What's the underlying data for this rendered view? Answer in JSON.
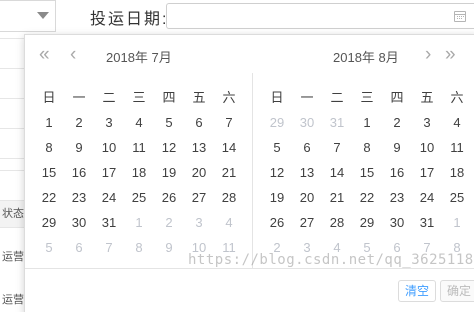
{
  "form": {
    "date_label": "投运日期:",
    "status_label": "状态",
    "row_labels": [
      "运营",
      "运营"
    ]
  },
  "picker": {
    "nav": {
      "prev_year": "«",
      "prev_month": "‹",
      "next_month": "›",
      "next_year": "»"
    },
    "weekdays": [
      "日",
      "一",
      "二",
      "三",
      "四",
      "五",
      "六"
    ],
    "left": {
      "title": "2018年  7月",
      "weeks": [
        [
          {
            "d": "1"
          },
          {
            "d": "2"
          },
          {
            "d": "3"
          },
          {
            "d": "4"
          },
          {
            "d": "5"
          },
          {
            "d": "6"
          },
          {
            "d": "7"
          }
        ],
        [
          {
            "d": "8"
          },
          {
            "d": "9"
          },
          {
            "d": "10"
          },
          {
            "d": "11"
          },
          {
            "d": "12"
          },
          {
            "d": "13"
          },
          {
            "d": "14"
          }
        ],
        [
          {
            "d": "15"
          },
          {
            "d": "16"
          },
          {
            "d": "17"
          },
          {
            "d": "18"
          },
          {
            "d": "19"
          },
          {
            "d": "20"
          },
          {
            "d": "21"
          }
        ],
        [
          {
            "d": "22"
          },
          {
            "d": "23"
          },
          {
            "d": "24"
          },
          {
            "d": "25"
          },
          {
            "d": "26"
          },
          {
            "d": "27"
          },
          {
            "d": "28"
          }
        ],
        [
          {
            "d": "29"
          },
          {
            "d": "30"
          },
          {
            "d": "31"
          },
          {
            "d": "1",
            "dim": true
          },
          {
            "d": "2",
            "dim": true
          },
          {
            "d": "3",
            "dim": true
          },
          {
            "d": "4",
            "dim": true
          }
        ],
        [
          {
            "d": "5",
            "dim": true
          },
          {
            "d": "6",
            "dim": true
          },
          {
            "d": "7",
            "dim": true
          },
          {
            "d": "8",
            "dim": true
          },
          {
            "d": "9",
            "dim": true
          },
          {
            "d": "10",
            "dim": true
          },
          {
            "d": "11",
            "dim": true
          }
        ]
      ]
    },
    "right": {
      "title": "2018年  8月",
      "weeks": [
        [
          {
            "d": "29",
            "dim": true
          },
          {
            "d": "30",
            "dim": true
          },
          {
            "d": "31",
            "dim": true
          },
          {
            "d": "1"
          },
          {
            "d": "2"
          },
          {
            "d": "3"
          },
          {
            "d": "4"
          }
        ],
        [
          {
            "d": "5"
          },
          {
            "d": "6"
          },
          {
            "d": "7"
          },
          {
            "d": "8"
          },
          {
            "d": "9"
          },
          {
            "d": "10"
          },
          {
            "d": "11"
          }
        ],
        [
          {
            "d": "12"
          },
          {
            "d": "13"
          },
          {
            "d": "14"
          },
          {
            "d": "15"
          },
          {
            "d": "16"
          },
          {
            "d": "17"
          },
          {
            "d": "18"
          }
        ],
        [
          {
            "d": "19"
          },
          {
            "d": "20"
          },
          {
            "d": "21"
          },
          {
            "d": "22"
          },
          {
            "d": "23"
          },
          {
            "d": "24"
          },
          {
            "d": "25"
          }
        ],
        [
          {
            "d": "26"
          },
          {
            "d": "27"
          },
          {
            "d": "28"
          },
          {
            "d": "29"
          },
          {
            "d": "30"
          },
          {
            "d": "31"
          },
          {
            "d": "1",
            "dim": true
          }
        ],
        [
          {
            "d": "2",
            "dim": true
          },
          {
            "d": "3",
            "dim": true
          },
          {
            "d": "4",
            "dim": true
          },
          {
            "d": "5",
            "dim": true
          },
          {
            "d": "6",
            "dim": true
          },
          {
            "d": "7",
            "dim": true
          },
          {
            "d": "8",
            "dim": true
          }
        ]
      ]
    },
    "footer": {
      "clear_label": "清空",
      "ok_label": "确定"
    }
  },
  "watermark": "https://blog.csdn.net/qq_36251189",
  "colors": {
    "accent": "#409eff",
    "dim_text": "#c0c4cc",
    "text": "#404040",
    "border": "#dcdcdc"
  }
}
